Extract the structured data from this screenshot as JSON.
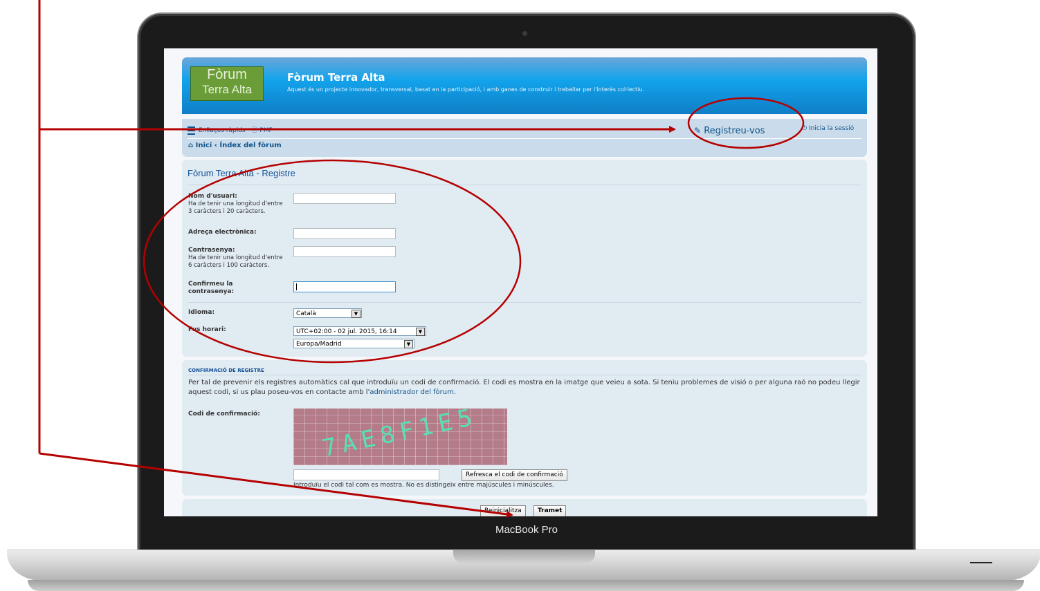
{
  "device": {
    "label": "MacBook Pro"
  },
  "site": {
    "logo_line1": "Fòrum",
    "logo_line2": "Terra Alta",
    "title": "Fòrum Terra Alta",
    "description": "Aquest és un projecte innovador, transversal, basat en la participació, i amb ganes de construir i treballar per l'interès col·lectiu."
  },
  "nav": {
    "quick_links": "Enllaços ràpids",
    "faq": "PMF",
    "register": "Registreu-vos",
    "login": "Inicia la sessió",
    "breadcrumb_home": "Inici",
    "breadcrumb_sep": "‹",
    "breadcrumb_index": "Índex del fòrum"
  },
  "form": {
    "title": "Fòrum Terra Alta - Registre",
    "username_label": "Nom d'usuari:",
    "username_hint": "Ha de tenir una longitud d'entre 3 caràcters i 20 caràcters.",
    "email_label": "Adreça electrònica:",
    "password_label": "Contrasenya:",
    "password_hint": "Ha de tenir una longitud d'entre 6 caràcters i 100 caràcters.",
    "confirm_label": "Confirmeu la contrasenya:",
    "language_label": "Idioma:",
    "language_value": "Català",
    "timezone_label": "Fus horari:",
    "timezone_value": "UTC+02:00 - 02 jul. 2015, 16:14",
    "timezone_region": "Europa/Madrid"
  },
  "confirmation": {
    "title": "CONFIRMACIÓ DE REGISTRE",
    "description_main": "Per tal de prevenir els registres automàtics cal que introduïu un codi de confirmació. El codi es mostra en la imatge que veieu a sota. Si teniu problemes de visió o per alguna raó no podeu llegir aquest codi, si us plau poseu-vos en contacte amb l'",
    "admin_link": "administrador del fòrum",
    "description_end": ".",
    "code_label": "Codi de confirmació:",
    "captcha_text": "7AE8F1E5",
    "refresh_button": "Refresca el codi de confirmació",
    "note": "Introduïu el codi tal com es mostra. No es distingeix entre majúscules i minúscules."
  },
  "actions": {
    "reset_button": "Reinicialitza",
    "submit_button": "Tramet"
  },
  "colors": {
    "header_blue": "#12a3eb",
    "panel_bg": "#e1ebf2",
    "link_blue": "#105289",
    "annotation_red": "#b50000"
  }
}
